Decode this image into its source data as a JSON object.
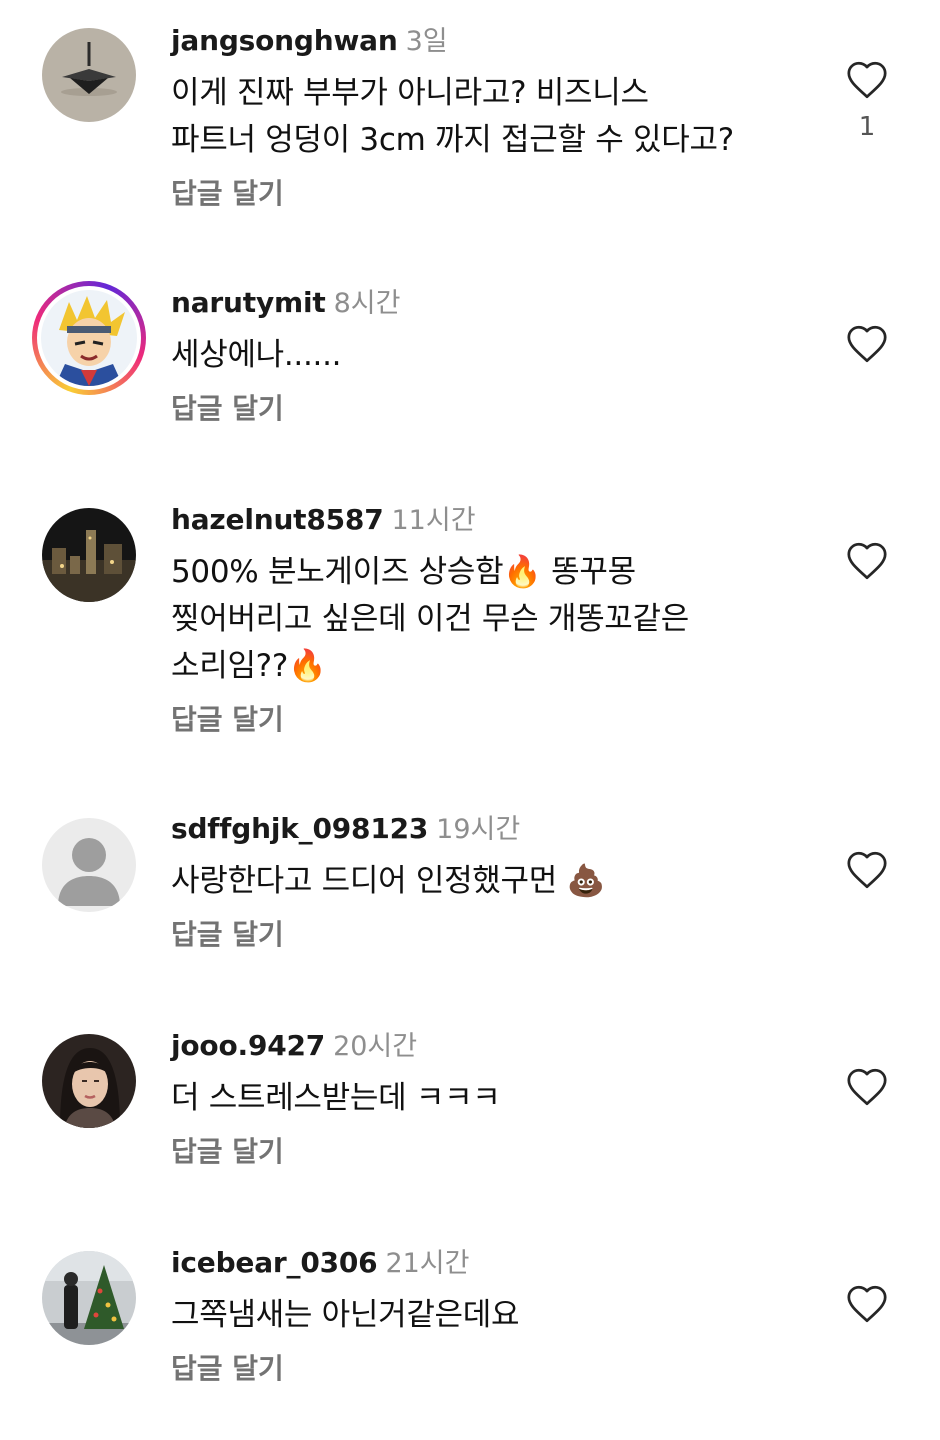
{
  "colors": {
    "username": "#1a1a1a",
    "timestamp": "#8e8e8e",
    "reply": "#737373",
    "heart_outline": "#262626"
  },
  "comments": [
    {
      "username": "jangsonghwan",
      "time": "3일",
      "text_lines": [
        "이게 진짜 부부가 아니라고? 비즈니스",
        "파트너 엉덩이 3cm 까지 접근할 수 있다고?"
      ],
      "reply_label": "답글 달기",
      "likes": "1",
      "avatar_icon": "spinning-top-icon"
    },
    {
      "username": "narutymit",
      "time": "8시간",
      "text_lines": [
        "세상에나......"
      ],
      "reply_label": "답글 달기",
      "avatar_icon": "anime-character-avatar"
    },
    {
      "username": "hazelnut8587",
      "time": "11시간",
      "text_lines": [
        "500% 분노게이즈 상승함🔥 똥꾸몽",
        "찢어버리고 싶은데 이건 무슨 개똥꼬같은",
        "소리임??🔥"
      ],
      "reply_label": "답글 달기",
      "avatar_icon": "night-city-avatar"
    },
    {
      "username": "sdffghjk_098123",
      "time": "19시간",
      "text_lines": [
        "사랑한다고 드디어 인정했구먼 💩"
      ],
      "reply_label": "답글 달기",
      "avatar_icon": "default-user-icon"
    },
    {
      "username": "jooo.9427",
      "time": "20시간",
      "text_lines": [
        "더 스트레스받는데 ㅋㅋㅋ"
      ],
      "reply_label": "답글 달기",
      "avatar_icon": "portrait-avatar"
    },
    {
      "username": "icebear_0306",
      "time": "21시간",
      "text_lines": [
        "그쪽냄새는 아닌거같은데요"
      ],
      "reply_label": "답글 달기",
      "avatar_icon": "christmas-tree-avatar"
    }
  ]
}
